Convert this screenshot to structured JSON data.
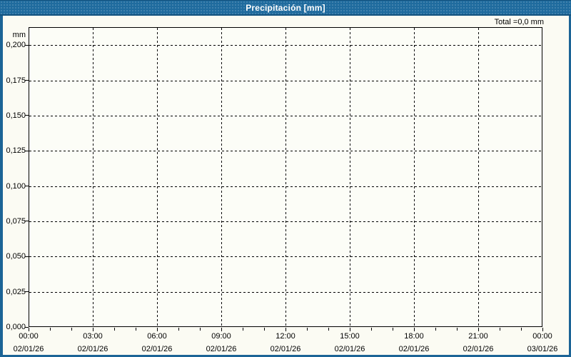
{
  "window": {
    "title": "Precipitación [mm]",
    "total_label": "Total =0,0 mm"
  },
  "colors": {
    "header_bg": "#1f6b9e",
    "header_edge": "#12527e",
    "frame": "#1c6496",
    "background": "#fbfbf3",
    "plot_bg": "#fcfdf7",
    "grid": "#000000",
    "text": "#000000",
    "title_text": "#ffffff"
  },
  "chart_data": {
    "type": "line",
    "title": "Precipitación [mm]",
    "ylabel": "mm",
    "total_annotation": "Total =0,0 mm",
    "grid_style": "dashed",
    "legend": "none",
    "series": [],
    "x_range_hours": 24,
    "major_x_tick_hours": 3,
    "minor_x_tick_hours": 1,
    "x_ticks": [
      {
        "time": "00:00",
        "date": "02/01/26"
      },
      {
        "time": "03:00",
        "date": "02/01/26"
      },
      {
        "time": "06:00",
        "date": "02/01/26"
      },
      {
        "time": "09:00",
        "date": "02/01/26"
      },
      {
        "time": "12:00",
        "date": "02/01/26"
      },
      {
        "time": "15:00",
        "date": "02/01/26"
      },
      {
        "time": "18:00",
        "date": "02/01/26"
      },
      {
        "time": "21:00",
        "date": "02/01/26"
      },
      {
        "time": "00:00",
        "date": "03/01/26"
      }
    ],
    "y_ticks": [
      {
        "label": "0,200",
        "value": 0.2
      },
      {
        "label": "0,175",
        "value": 0.175
      },
      {
        "label": "0,150",
        "value": 0.15
      },
      {
        "label": "0,125",
        "value": 0.125
      },
      {
        "label": "0,100",
        "value": 0.1
      },
      {
        "label": "0,075",
        "value": 0.075
      },
      {
        "label": "0,050",
        "value": 0.05
      },
      {
        "label": "0,025",
        "value": 0.025
      },
      {
        "label": "0,000",
        "value": 0.0
      }
    ],
    "ylim": [
      0,
      0.2128
    ]
  }
}
